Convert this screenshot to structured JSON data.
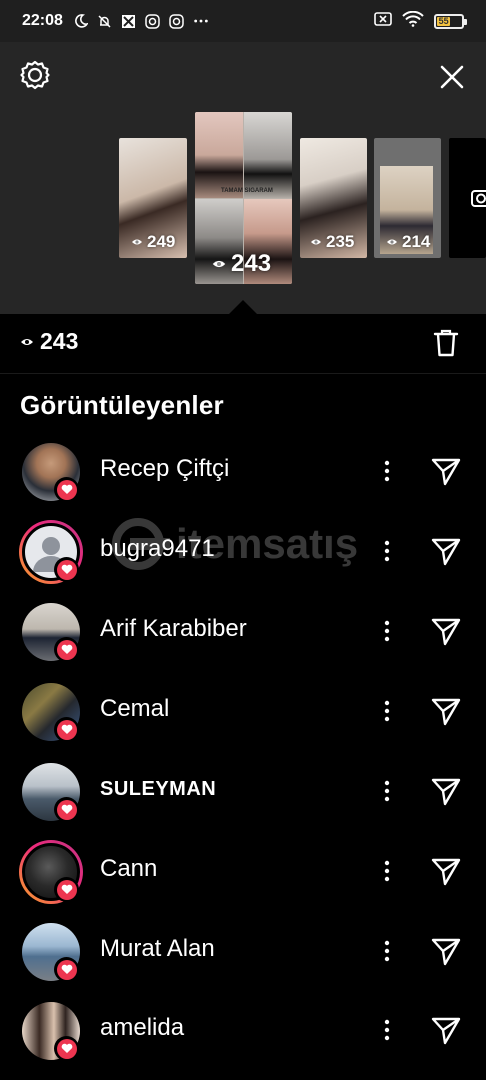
{
  "status_bar": {
    "time": "22:08",
    "battery_level": "55"
  },
  "stories": [
    {
      "views": "249"
    },
    {
      "views": "243",
      "caption": "TAMAM SIGARAM"
    },
    {
      "views": "235"
    },
    {
      "views": "214"
    }
  ],
  "summary": {
    "view_count": "243"
  },
  "section_title": "Görüntüleyenler",
  "viewers": [
    {
      "name": "Recep Çiftçi",
      "ring": false
    },
    {
      "name": "bugra9471",
      "ring": true
    },
    {
      "name": "Arif Karabiber",
      "ring": false
    },
    {
      "name": "Cemal",
      "ring": false
    },
    {
      "name": "SULEYMAN",
      "ring": false
    },
    {
      "name": "Cann",
      "ring": true
    },
    {
      "name": "Murat Alan",
      "ring": false
    },
    {
      "name": "amelida",
      "ring": false
    }
  ],
  "watermark": {
    "text": "itemsatış"
  },
  "colors": {
    "heart": "#ed3550",
    "ring_start": "#f9a826",
    "ring_end": "#c13584",
    "strip_bg": "#262626"
  }
}
